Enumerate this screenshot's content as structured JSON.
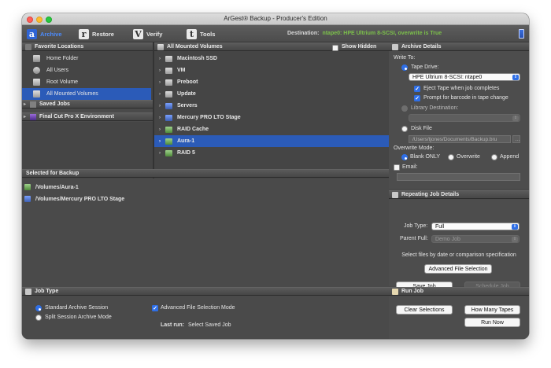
{
  "window": {
    "title": "ArGest® Backup - Producer's Edition"
  },
  "toolbar": {
    "tools": [
      {
        "glyph": "a",
        "label": "Archive"
      },
      {
        "glyph": "r",
        "label": "Restore"
      },
      {
        "glyph": "V",
        "label": "Verify"
      },
      {
        "glyph": "t",
        "label": "Tools"
      }
    ],
    "destination_label": "Destination:",
    "destination_value": "ntape0: HPE Ultrium 8-SCSI, overwrite is True"
  },
  "favorites": {
    "header": "Favorite Locations",
    "items": [
      "Home Folder",
      "All Users",
      "Root Volume",
      "All Mounted Volumes"
    ],
    "saved_jobs": "Saved Jobs",
    "fcp_env": "Final Cut Pro X Environment"
  },
  "volumes": {
    "header": "All Mounted Volumes",
    "show_hidden": "Show Hidden",
    "items": [
      "Macintosh SSD",
      "VM",
      "Preboot",
      "Update",
      "Servers",
      "Mercury PRO LTO Stage",
      "RAID Cache",
      "Aura-1",
      "RAID 5"
    ]
  },
  "backup": {
    "header": "Selected for Backup",
    "items": [
      "/Volumes/Aura-1",
      "/Volumes/Mercury PRO LTO Stage"
    ]
  },
  "archive_details": {
    "header": "Archive Details",
    "write_to": "Write To:",
    "tape_drive": "Tape Drive:",
    "tape_select": "HPE Ultrium 8-SCSI: ntape0",
    "eject": "Eject Tape when job completes",
    "prompt": "Prompt for barcode in tape change",
    "library": "Library Destination:",
    "disk_file": "Disk File",
    "disk_path": "/Users/tjones/Documents/Backup.bru",
    "overwrite_mode": "Overwrite Mode:",
    "modes": [
      "Blank ONLY",
      "Overwrite",
      "Append"
    ],
    "email": "Email:"
  },
  "repeating": {
    "header": "Repeating Job Details",
    "job_type_label": "Job Type:",
    "job_type_value": "Full",
    "parent_label": "Parent Full:",
    "parent_value": "Demo Job",
    "select_text": "Select files by date or comparison specification",
    "adv_button": "Advanced File Selection",
    "save_job": "Save Job",
    "schedule_job": "Schedule Job"
  },
  "job_type": {
    "header": "Job Type",
    "standard": "Standard Archive Session",
    "split": "Split Session Archive Mode",
    "advanced": "Advanced File Selection Mode",
    "last_run_label": "Last run:",
    "last_run_value": "Select Saved Job"
  },
  "run_job": {
    "header": "Run Job",
    "clear": "Clear Selections",
    "how_many": "How Many Tapes",
    "run_now": "Run Now"
  },
  "colors": {
    "accent": "#2f6fe6",
    "selection": "#2b5bb8",
    "destination": "#7cc14a"
  }
}
